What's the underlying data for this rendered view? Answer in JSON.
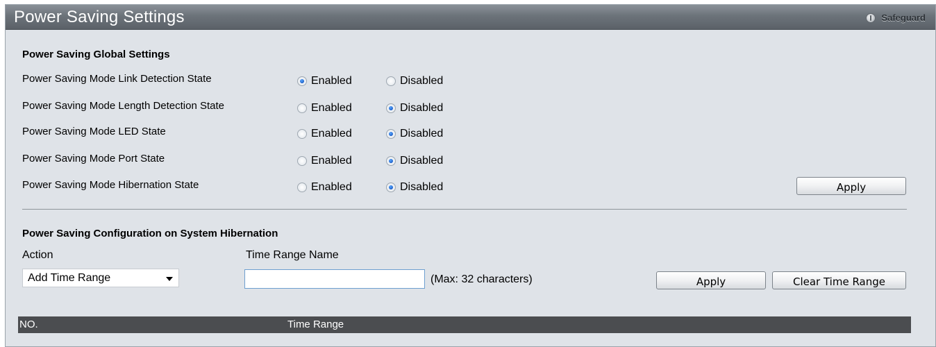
{
  "header": {
    "title": "Power Saving Settings",
    "safeguard_label": "Safeguard"
  },
  "global_settings": {
    "section_title": "Power Saving Global Settings",
    "rows": [
      {
        "label": "Power Saving Mode Link Detection State",
        "enabled_label": "Enabled",
        "disabled_label": "Disabled",
        "selected": "Enabled"
      },
      {
        "label": "Power Saving Mode Length Detection State",
        "enabled_label": "Enabled",
        "disabled_label": "Disabled",
        "selected": "Disabled"
      },
      {
        "label": "Power Saving Mode LED State",
        "enabled_label": "Enabled",
        "disabled_label": "Disabled",
        "selected": "Disabled"
      },
      {
        "label": "Power Saving Mode Port State",
        "enabled_label": "Enabled",
        "disabled_label": "Disabled",
        "selected": "Disabled"
      },
      {
        "label": "Power Saving Mode Hibernation State",
        "enabled_label": "Enabled",
        "disabled_label": "Disabled",
        "selected": "Disabled"
      }
    ],
    "apply_label": "Apply"
  },
  "hibernation": {
    "section_title": "Power Saving Configuration on System Hibernation",
    "action_label": "Action",
    "time_range_name_label": "Time Range Name",
    "action_selected": "Add Time Range",
    "time_range_value": "",
    "hint": "(Max: 32 characters)",
    "apply_label": "Apply",
    "clear_label": "Clear Time Range"
  },
  "table": {
    "columns": [
      "NO.",
      "Time Range"
    ]
  },
  "colors": {
    "panel_bg": "#dfe3e8",
    "title_bar": "#6c737a",
    "table_header": "#4b4d50",
    "radio_selected": "#1c5fc8"
  }
}
